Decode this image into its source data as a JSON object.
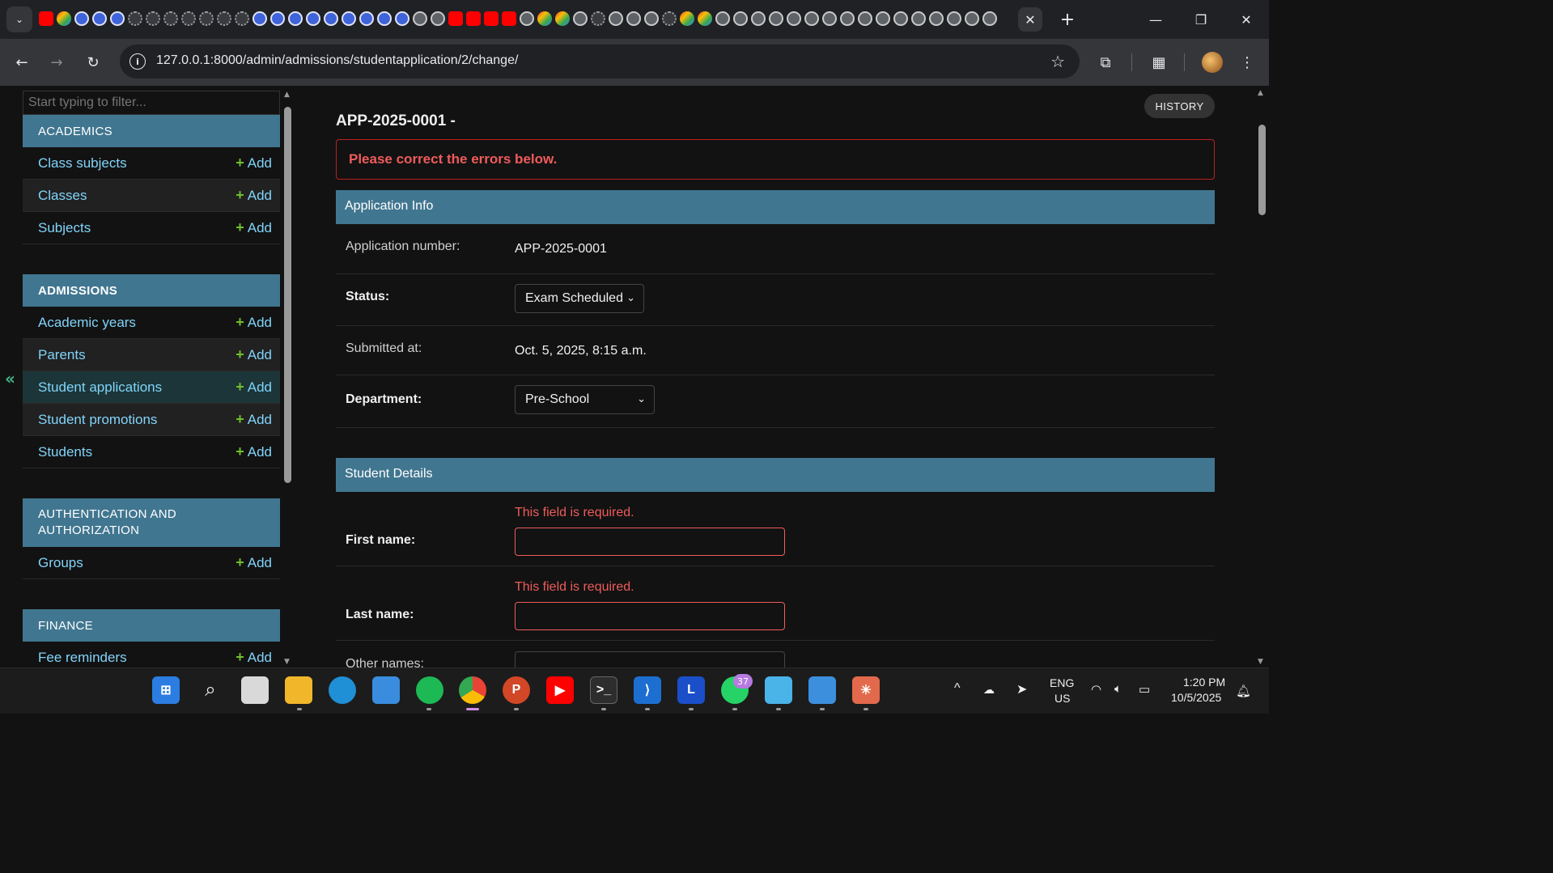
{
  "browser": {
    "url": "127.0.0.1:8000/admin/admissions/studentapplication/2/change/",
    "window_controls": {
      "minimize": "—",
      "restore": "❐",
      "close": "✕"
    }
  },
  "sidebar": {
    "filter_placeholder": "Start typing to filter...",
    "collapse_glyph": "«",
    "add_label": "Add",
    "modules": [
      {
        "caption": "ACADEMICS",
        "models": [
          "Class subjects",
          "Classes",
          "Subjects"
        ]
      },
      {
        "caption": "ADMISSIONS",
        "models": [
          "Academic years",
          "Parents",
          "Student applications",
          "Student promotions",
          "Students"
        ]
      },
      {
        "caption": "AUTHENTICATION AND AUTHORIZATION",
        "models": [
          "Groups"
        ]
      },
      {
        "caption": "FINANCE",
        "models": [
          "Fee reminders"
        ]
      }
    ]
  },
  "main": {
    "history_button": "HISTORY",
    "object_title": "APP-2025-0001 -",
    "error_note": "Please correct the errors below.",
    "fieldsets": [
      {
        "title": "Application Info",
        "fields": [
          {
            "label": "Application number:",
            "value": "APP-2025-0001"
          },
          {
            "label": "Status:",
            "value": "Exam Scheduled"
          },
          {
            "label": "Submitted at:",
            "value": "Oct. 5, 2025, 8:15 a.m."
          },
          {
            "label": "Department:",
            "value": "Pre-School"
          }
        ]
      },
      {
        "title": "Student Details",
        "fields": [
          {
            "label": "First name:",
            "error": "This field is required.",
            "value": ""
          },
          {
            "label": "Last name:",
            "error": "This field is required.",
            "value": ""
          },
          {
            "label": "Other names:",
            "value": ""
          }
        ]
      }
    ]
  },
  "taskbar": {
    "whatsapp_badge": "37",
    "lang": "ENG",
    "region": "US",
    "time": "1:20 PM",
    "date": "10/5/2025"
  }
}
